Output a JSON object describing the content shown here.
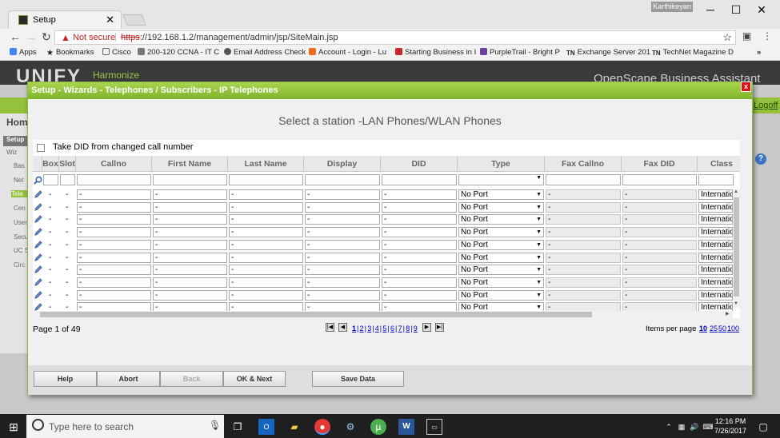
{
  "browser": {
    "tab_title": "Setup",
    "user": "Karthikeyan",
    "not_secure": "Not secure",
    "url_scheme": "https",
    "url_rest": "://192.168.1.2/management/admin/jsp/SiteMain.jsp",
    "bookmarks": [
      "Apps",
      "Bookmarks",
      "Cisco",
      "200-120 CCNA - IT C",
      "Email Address Check",
      "Account - Login - Lu",
      "Starting Business in I",
      "PurpleTrail - Bright P",
      "Exchange Server 201",
      "TechNet Magazine D"
    ]
  },
  "app": {
    "logo": "UNIFY",
    "harmonize": "Harmonize",
    "product": "OpenScape Business Assistant",
    "logoff": "Logoff",
    "home": "Hom",
    "sidebar": [
      "Setup",
      "Wiz",
      "Bas",
      "Net",
      "Tele",
      "Cen",
      "User",
      "Secu",
      "UC S",
      "Circ"
    ]
  },
  "dialog": {
    "title": "Setup - Wizards - Telephones / Subscribers - IP Telephones",
    "close": "x",
    "subtitle": "Select a station -LAN Phones/WLAN Phones",
    "checkbox_label": "Take DID from changed call number",
    "columns": [
      "Box",
      "Slot",
      "Callno",
      "First Name",
      "Last Name",
      "Display",
      "DID",
      "Type",
      "Fax Callno",
      "Fax DID",
      "Class"
    ],
    "rows": [
      {
        "box": "-",
        "slot": "-",
        "callno": "-",
        "first": "-",
        "last": "-",
        "display": "-",
        "did": "-",
        "type": "No Port",
        "fax_callno": "-",
        "fax_did": "-",
        "class": "Internatio"
      },
      {
        "box": "-",
        "slot": "-",
        "callno": "-",
        "first": "-",
        "last": "-",
        "display": "-",
        "did": "-",
        "type": "No Port",
        "fax_callno": "-",
        "fax_did": "-",
        "class": "Internatio"
      },
      {
        "box": "-",
        "slot": "-",
        "callno": "-",
        "first": "-",
        "last": "-",
        "display": "-",
        "did": "-",
        "type": "No Port",
        "fax_callno": "-",
        "fax_did": "-",
        "class": "Internatio"
      },
      {
        "box": "-",
        "slot": "-",
        "callno": "-",
        "first": "-",
        "last": "-",
        "display": "-",
        "did": "-",
        "type": "No Port",
        "fax_callno": "-",
        "fax_did": "-",
        "class": "Internatio"
      },
      {
        "box": "-",
        "slot": "-",
        "callno": "-",
        "first": "-",
        "last": "-",
        "display": "-",
        "did": "-",
        "type": "No Port",
        "fax_callno": "-",
        "fax_did": "-",
        "class": "Internatio"
      },
      {
        "box": "-",
        "slot": "-",
        "callno": "-",
        "first": "-",
        "last": "-",
        "display": "-",
        "did": "-",
        "type": "No Port",
        "fax_callno": "-",
        "fax_did": "-",
        "class": "Internatio"
      },
      {
        "box": "-",
        "slot": "-",
        "callno": "-",
        "first": "-",
        "last": "-",
        "display": "-",
        "did": "-",
        "type": "No Port",
        "fax_callno": "-",
        "fax_did": "-",
        "class": "Internatio"
      },
      {
        "box": "-",
        "slot": "-",
        "callno": "-",
        "first": "-",
        "last": "-",
        "display": "-",
        "did": "-",
        "type": "No Port",
        "fax_callno": "-",
        "fax_did": "-",
        "class": "Internatio"
      },
      {
        "box": "-",
        "slot": "-",
        "callno": "-",
        "first": "-",
        "last": "-",
        "display": "-",
        "did": "-",
        "type": "No Port",
        "fax_callno": "-",
        "fax_did": "-",
        "class": "Internatio"
      },
      {
        "box": "-",
        "slot": "-",
        "callno": "-",
        "first": "-",
        "last": "-",
        "display": "-",
        "did": "-",
        "type": "No Port",
        "fax_callno": "-",
        "fax_did": "-",
        "class": "Internatio"
      }
    ],
    "page_info": "Page 1 of 49",
    "pages": [
      "1",
      "2",
      "3",
      "4",
      "5",
      "6",
      "7",
      "8",
      "9"
    ],
    "items_per_page_label": "Items per page",
    "items_per_page": [
      "10",
      "25",
      "50",
      "100"
    ],
    "buttons": {
      "help": "Help",
      "abort": "Abort",
      "back": "Back",
      "ok_next": "OK & Next",
      "save": "Save Data"
    }
  },
  "taskbar": {
    "search_placeholder": "Type here to search",
    "time": "12:16 PM",
    "date": "7/26/2017"
  }
}
